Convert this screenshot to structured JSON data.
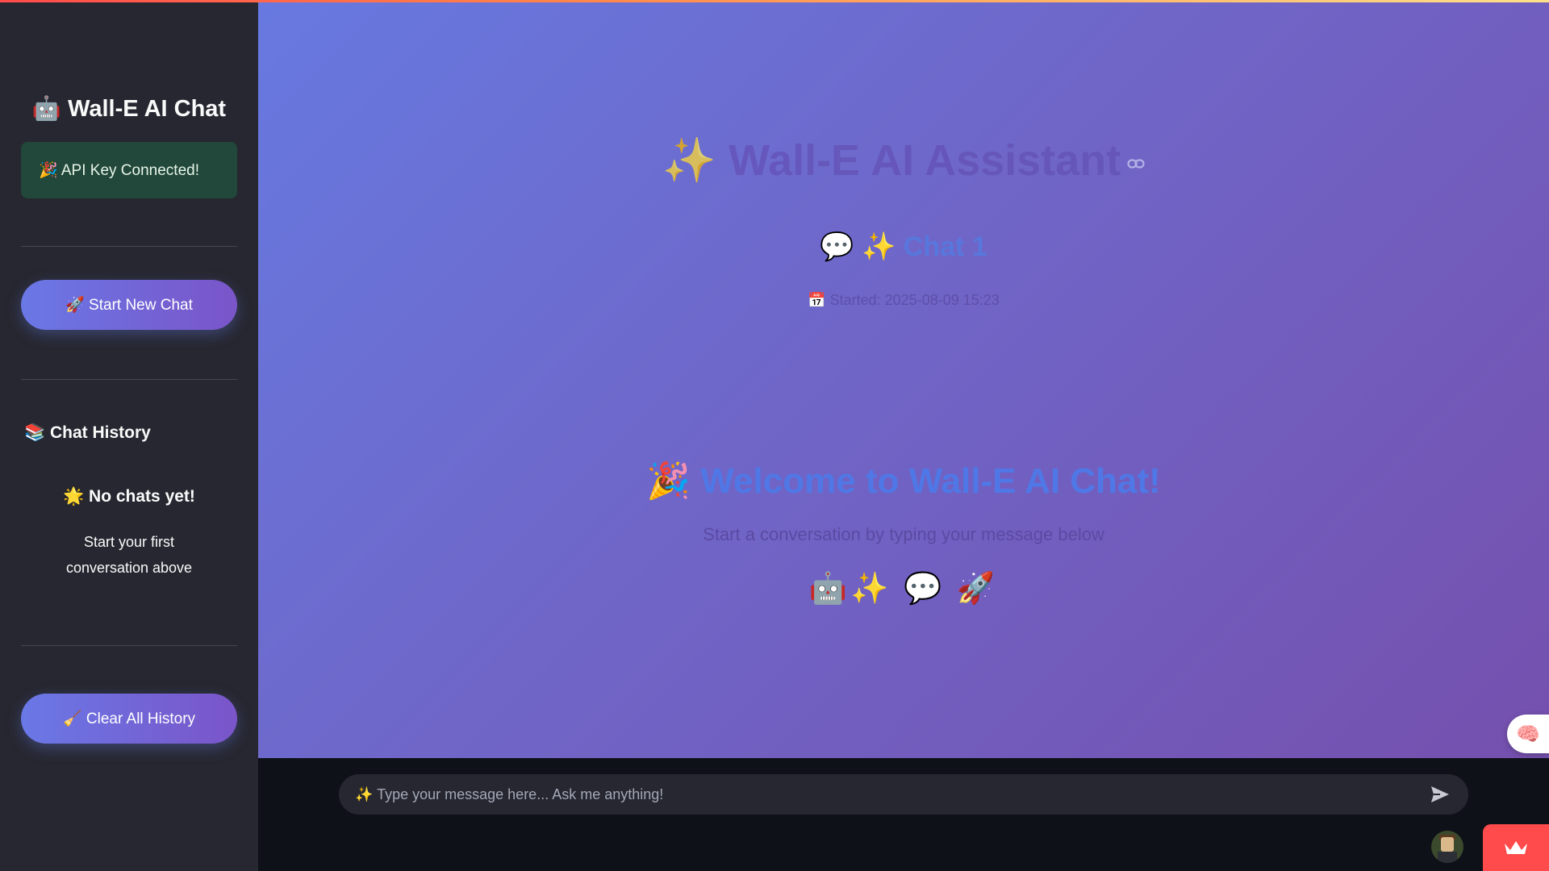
{
  "sidebar": {
    "title": "🤖 Wall-E AI Chat",
    "api_status": "🎉 API Key Connected!",
    "new_chat_button": "🚀 Start New Chat",
    "history_heading": "📚 Chat History",
    "empty_title": "🌟 No chats yet!",
    "empty_subtitle": "Start your first conversation above",
    "clear_button": "🧹 Clear All History"
  },
  "main": {
    "assistant_title": "✨ Wall-E AI Assistant",
    "chat_name": "💬 ✨ Chat 1",
    "started": "📅 Started: 2025-08-09 15:23",
    "welcome_title": "🎉 Welcome to Wall-E AI Chat!",
    "welcome_subtitle": "Start a conversation by typing your message below",
    "emoji_row": "🤖✨ 💬 🚀",
    "fab_icon": "🧠"
  },
  "chat_input": {
    "placeholder": "✨ Type your message here... Ask me anything!"
  },
  "colors": {
    "sidebar_bg": "#262730",
    "main_gradient_start": "#6779e0",
    "main_gradient_end": "#7550ae",
    "accent_red": "#ff4b4b",
    "success_bg": "#21483a"
  }
}
